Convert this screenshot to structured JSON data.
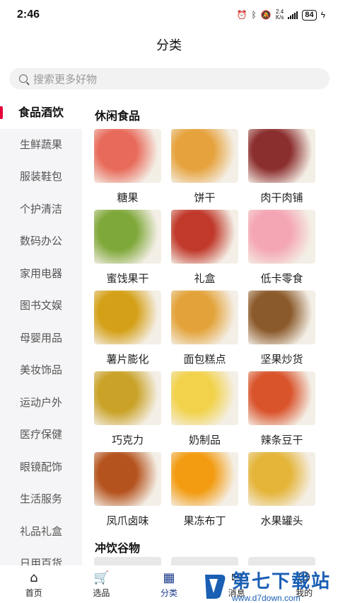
{
  "status": {
    "time": "2:46",
    "speed_top": "2.4",
    "speed_bottom": "K/s",
    "battery": "84"
  },
  "header": {
    "title": "分类"
  },
  "search": {
    "placeholder": "搜索更多好物"
  },
  "sidebar": {
    "items": [
      {
        "label": "食品酒饮",
        "active": true
      },
      {
        "label": "生鲜蔬果"
      },
      {
        "label": "服装鞋包"
      },
      {
        "label": "个护清洁"
      },
      {
        "label": "数码办公"
      },
      {
        "label": "家用电器"
      },
      {
        "label": "图书文娱"
      },
      {
        "label": "母婴用品"
      },
      {
        "label": "美妆饰品"
      },
      {
        "label": "运动户外"
      },
      {
        "label": "医疗保健"
      },
      {
        "label": "眼镜配饰"
      },
      {
        "label": "生活服务"
      },
      {
        "label": "礼品礼盒"
      },
      {
        "label": "日用百货"
      }
    ]
  },
  "main": {
    "section1_title": "休闲食品",
    "section2_title": "冲饮谷物",
    "categories": [
      {
        "label": "糖果",
        "icon": "candy-image",
        "color": "#e86a5a"
      },
      {
        "label": "饼干",
        "icon": "biscuit-image",
        "color": "#e6a23c"
      },
      {
        "label": "肉干肉铺",
        "icon": "jerky-image",
        "color": "#8b2e2e"
      },
      {
        "label": "蜜饯果干",
        "icon": "dried-fruit-image",
        "color": "#7fa83a"
      },
      {
        "label": "礼盒",
        "icon": "gift-box-image",
        "color": "#c0392b"
      },
      {
        "label": "低卡零食",
        "icon": "low-cal-snack-image",
        "color": "#f4a6b4"
      },
      {
        "label": "薯片膨化",
        "icon": "chips-image",
        "color": "#d4a017"
      },
      {
        "label": "面包糕点",
        "icon": "bread-image",
        "color": "#e3a33a"
      },
      {
        "label": "坚果炒货",
        "icon": "nuts-image",
        "color": "#8b5a2b"
      },
      {
        "label": "巧克力",
        "icon": "chocolate-image",
        "color": "#c9a227"
      },
      {
        "label": "奶制品",
        "icon": "cheese-image",
        "color": "#f2d24a"
      },
      {
        "label": "辣条豆干",
        "icon": "spicy-strip-image",
        "color": "#d9532b"
      },
      {
        "label": "凤爪卤味",
        "icon": "chicken-feet-image",
        "color": "#b5531e"
      },
      {
        "label": "果冻布丁",
        "icon": "jelly-image",
        "color": "#f39c12"
      },
      {
        "label": "水果罐头",
        "icon": "canned-fruit-image",
        "color": "#e5b53a"
      }
    ]
  },
  "tabbar": {
    "items": [
      {
        "label": "首页",
        "icon": "home-icon"
      },
      {
        "label": "选品",
        "icon": "cart-icon"
      },
      {
        "label": "分类",
        "icon": "category-icon",
        "active": true
      },
      {
        "label": "消息",
        "icon": "message-icon"
      },
      {
        "label": "我的",
        "icon": "user-icon"
      }
    ]
  },
  "watermark": {
    "main": "第七下载站",
    "sub": "www.d7down.com"
  }
}
